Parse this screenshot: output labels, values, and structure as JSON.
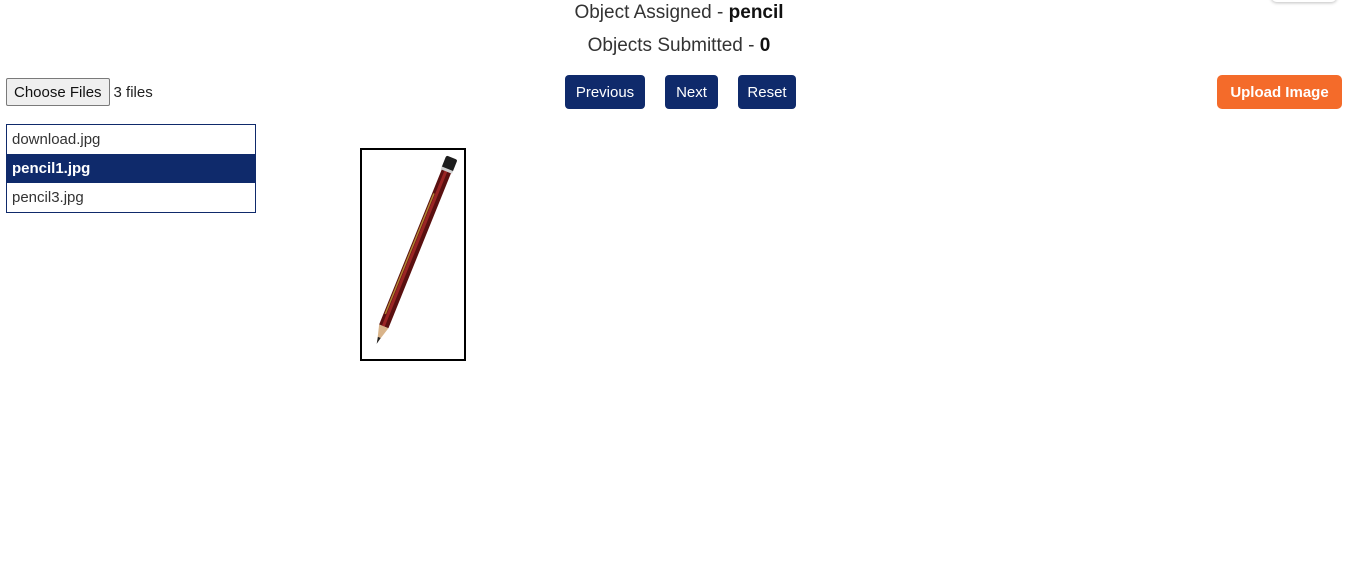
{
  "header": {
    "assigned_label": "Object Assigned - ",
    "assigned_value": "pencil",
    "submitted_label": "Objects Submitted - ",
    "submitted_value": "0"
  },
  "file_input": {
    "button_label": "Choose Files",
    "status": "3 files"
  },
  "navigation": {
    "previous_label": "Previous",
    "next_label": "Next",
    "reset_label": "Reset"
  },
  "upload": {
    "label": "Upload Image"
  },
  "file_list": {
    "items": [
      {
        "name": "download.jpg",
        "selected": false
      },
      {
        "name": "pencil1.jpg",
        "selected": true
      },
      {
        "name": "pencil3.jpg",
        "selected": false
      }
    ]
  },
  "colors": {
    "primary": "#0f2a6b",
    "accent": "#f46b2a"
  },
  "preview": {
    "icon": "pencil-image"
  }
}
